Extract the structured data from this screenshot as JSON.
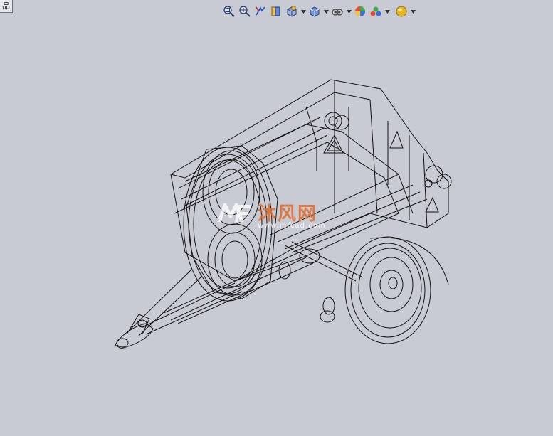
{
  "corner_tab": {
    "glyph": "品"
  },
  "toolbar": {
    "buttons": [
      {
        "name": "zoom-to-fit-icon",
        "dropdown": false
      },
      {
        "name": "zoom-to-area-icon",
        "dropdown": false
      },
      {
        "name": "previous-view-icon",
        "dropdown": false
      },
      {
        "name": "section-view-icon",
        "dropdown": false
      },
      {
        "name": "view-orientation-icon",
        "dropdown": true
      },
      {
        "name": "display-style-icon",
        "dropdown": true
      },
      {
        "name": "hide-show-items-icon",
        "dropdown": true
      },
      {
        "name": "edit-appearance-icon",
        "dropdown": false
      },
      {
        "name": "apply-scene-icon",
        "dropdown": true
      },
      {
        "name": "view-settings-icon",
        "dropdown": true
      }
    ]
  },
  "watermark": {
    "text": "沐风网",
    "url": "www.mfcad.com"
  },
  "colors": {
    "background": "#c8cbd3",
    "wire": "#111111",
    "watermark": "#e06a2a"
  }
}
